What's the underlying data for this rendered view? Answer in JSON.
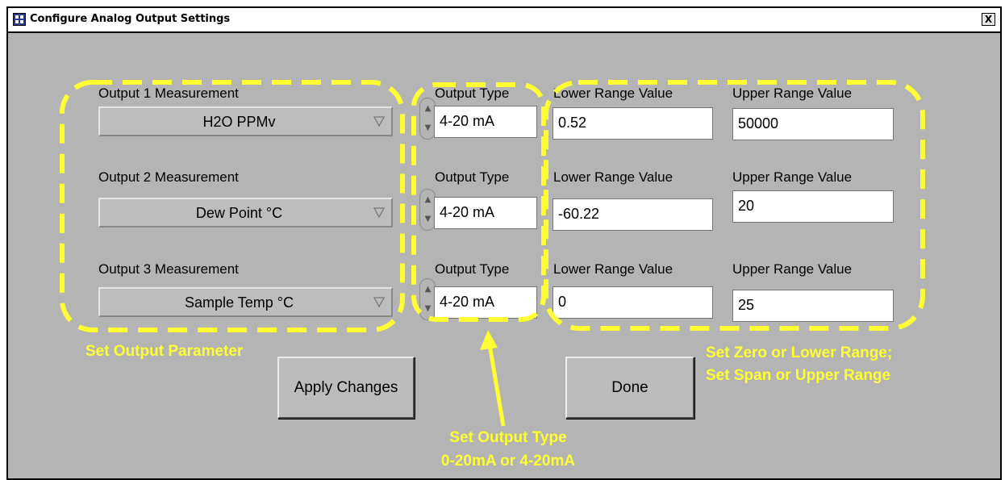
{
  "window": {
    "title": "Configure Analog Output Settings",
    "close_glyph": "X",
    "icon": "app-icon"
  },
  "rows": [
    {
      "measurement_label": "Output 1 Measurement",
      "measurement_value": "H2O PPMv",
      "type_label": "Output Type",
      "type_value": "4-20 mA",
      "lower_label": "Lower Range Value",
      "lower_value": "0.52",
      "upper_label": "Upper Range Value",
      "upper_value": "50000"
    },
    {
      "measurement_label": "Output 2 Measurement",
      "measurement_value": "Dew Point °C",
      "type_label": "Output Type",
      "type_value": "4-20 mA",
      "lower_label": "Lower Range Value",
      "lower_value": "-60.22",
      "upper_label": "Upper Range Value",
      "upper_value": "20"
    },
    {
      "measurement_label": "Output 3 Measurement",
      "measurement_value": "Sample Temp °C",
      "type_label": "Output Type",
      "type_value": "4-20 mA",
      "lower_label": "Lower Range Value",
      "lower_value": "0",
      "upper_label": "Upper Range Value",
      "upper_value": "25"
    }
  ],
  "buttons": {
    "apply": "Apply Changes",
    "done": "Done"
  },
  "annotations": {
    "parameter": "Set Output Parameter",
    "range_line1": "Set Zero or Lower Range;",
    "range_line2": "Set Span or Upper Range",
    "type_line1": "Set Output Type",
    "type_line2": "0-20mA or 4-20mA"
  },
  "colors": {
    "panel": "#b4b4b4",
    "annotation": "#ffff33",
    "field": "#ffffff"
  }
}
